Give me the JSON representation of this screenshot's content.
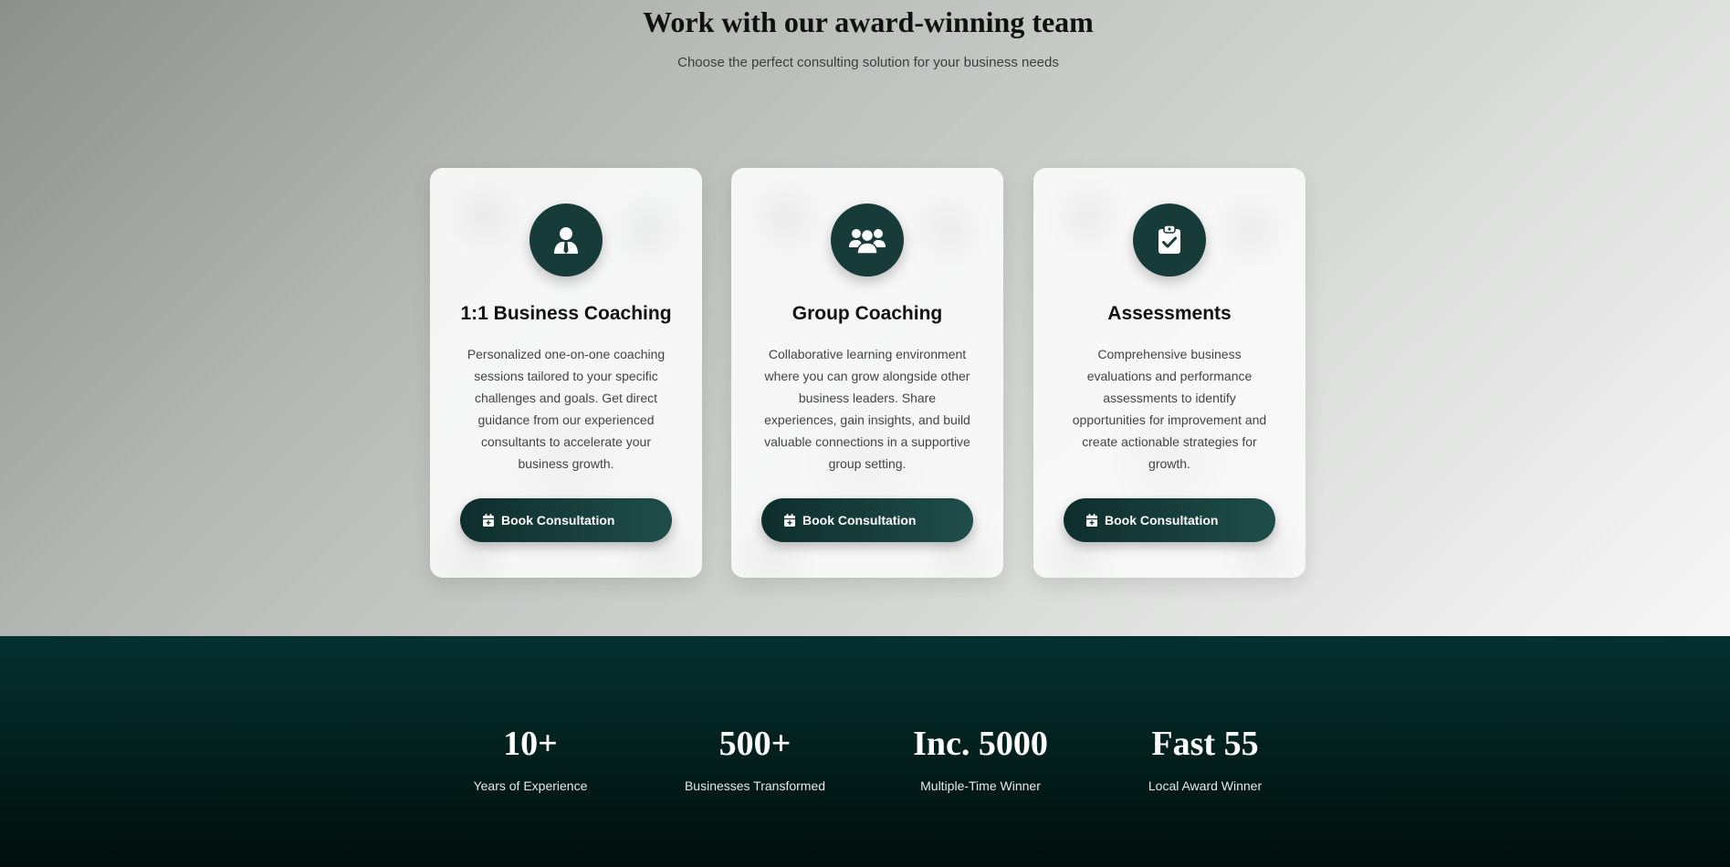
{
  "header": {
    "title": "Work with our award-winning team",
    "subtitle": "Choose the perfect consulting solution for your business needs"
  },
  "cards": [
    {
      "icon": "person-tie-icon",
      "title": "1:1 Business Coaching",
      "description": "Personalized one-on-one coaching sessions tailored to your specific challenges and goals. Get direct guidance from our experienced consultants to accelerate your business growth.",
      "button_icon": "calendar-plus-icon",
      "button_label": "Book Consultation"
    },
    {
      "icon": "users-group-icon",
      "title": "Group Coaching",
      "description": "Collaborative learning environment where you can grow alongside other business leaders. Share experiences, gain insights, and build valuable connections in a supportive group setting.",
      "button_icon": "calendar-plus-icon",
      "button_label": "Book Consultation"
    },
    {
      "icon": "clipboard-check-icon",
      "title": "Assessments",
      "description": "Comprehensive business evaluations and performance assessments to identify opportunities for improvement and create actionable strategies for growth.",
      "button_icon": "calendar-plus-icon",
      "button_label": "Book Consultation"
    }
  ],
  "stats": [
    {
      "value": "10+",
      "label": "Years of Experience"
    },
    {
      "value": "500+",
      "label": "Businesses Transformed"
    },
    {
      "value": "Inc. 5000",
      "label": "Multiple-Time Winner"
    },
    {
      "value": "Fast 55",
      "label": "Local Award Winner"
    }
  ],
  "colors": {
    "primary": "#173b39",
    "stats_background": "#042a28",
    "text_dark": "#111111"
  }
}
